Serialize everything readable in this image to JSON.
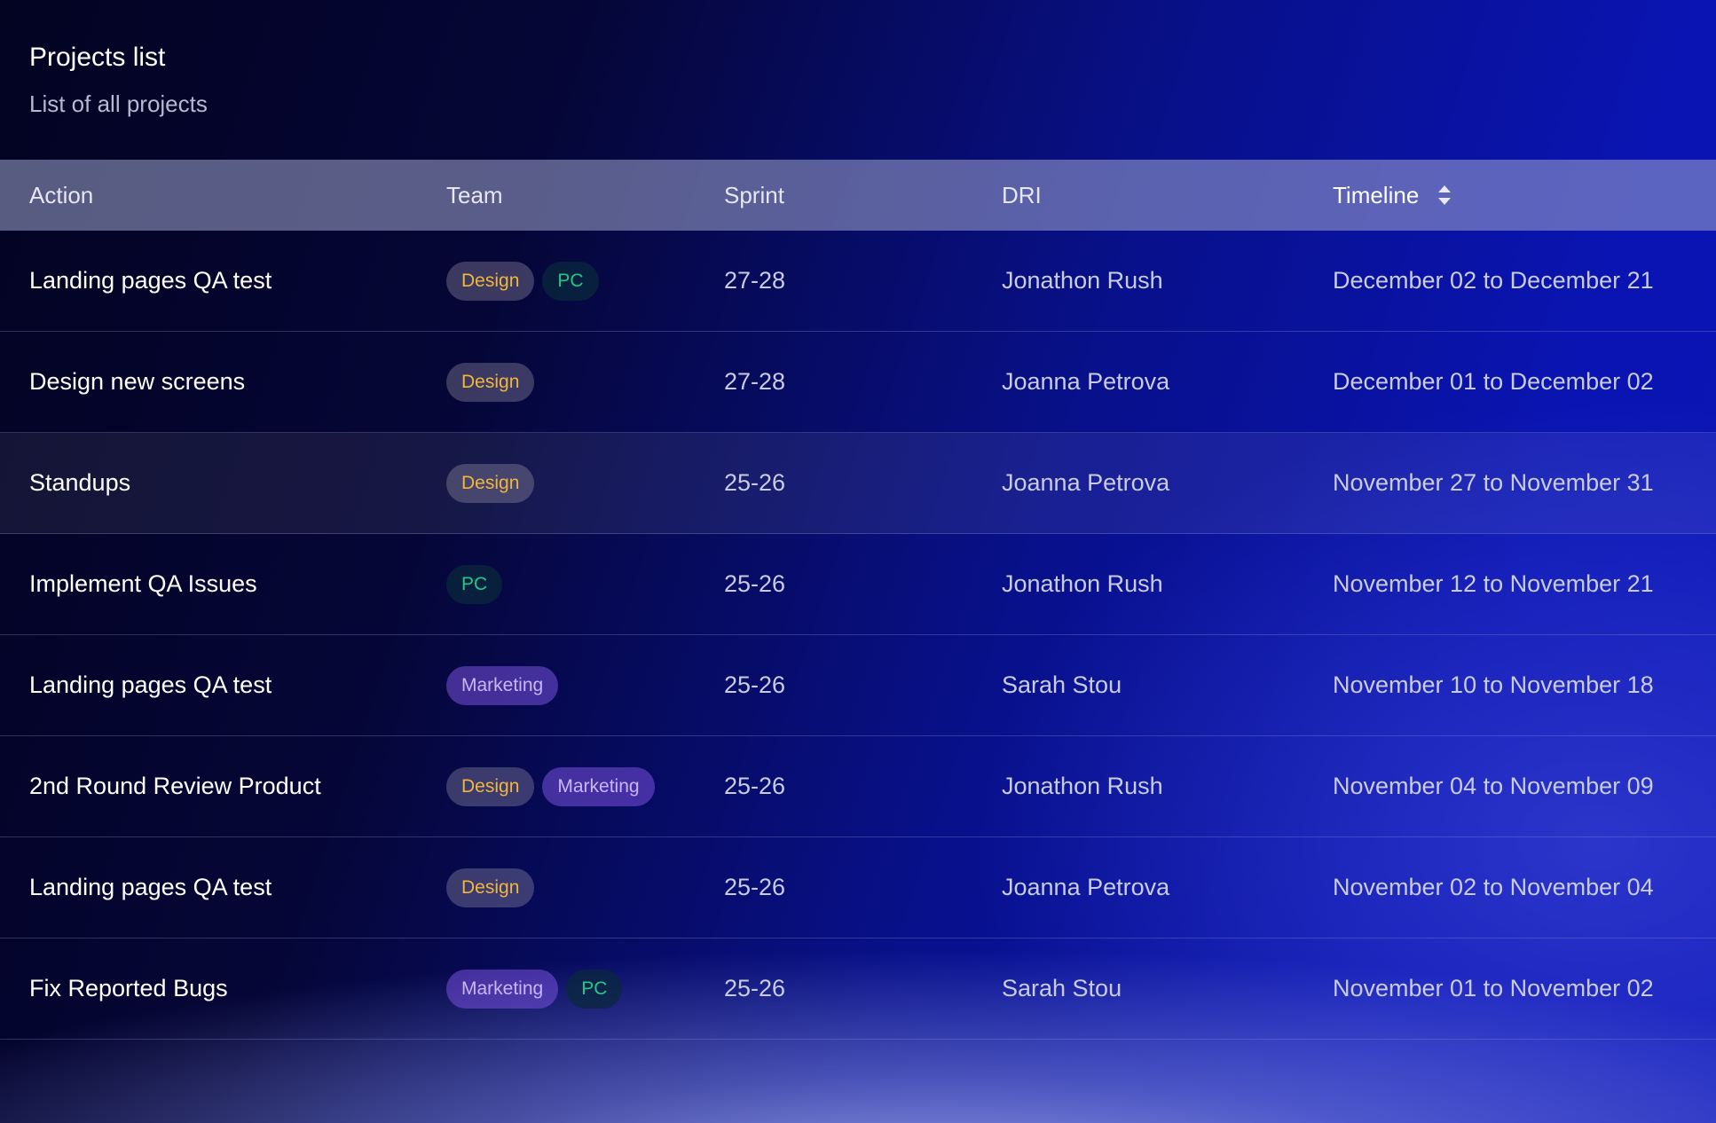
{
  "header": {
    "title": "Projects list",
    "subtitle": "List of all projects"
  },
  "table": {
    "columns": {
      "action": "Action",
      "team": "Team",
      "sprint": "Sprint",
      "dri": "DRI",
      "timeline": "Timeline"
    },
    "sorted_by": "timeline",
    "rows": [
      {
        "action": "Landing pages QA test",
        "tags": [
          "Design",
          "PC"
        ],
        "sprint": "27-28",
        "dri": "Jonathon Rush",
        "timeline": "December 02 to December 21"
      },
      {
        "action": "Design new screens",
        "tags": [
          "Design"
        ],
        "sprint": "27-28",
        "dri": "Joanna Petrova",
        "timeline": "December 01 to December 02"
      },
      {
        "action": "Standups",
        "tags": [
          "Design"
        ],
        "sprint": "25-26",
        "dri": "Joanna Petrova",
        "timeline": "November 27 to November 31"
      },
      {
        "action": "Implement QA Issues",
        "tags": [
          "PC"
        ],
        "sprint": "25-26",
        "dri": "Jonathon Rush",
        "timeline": "November 12 to November 21"
      },
      {
        "action": "Landing pages QA test",
        "tags": [
          "Marketing"
        ],
        "sprint": "25-26",
        "dri": "Sarah Stou",
        "timeline": "November 10 to November 18"
      },
      {
        "action": "2nd Round Review Product",
        "tags": [
          "Design",
          "Marketing"
        ],
        "sprint": "25-26",
        "dri": "Jonathon Rush",
        "timeline": "November 04 to November 09"
      },
      {
        "action": "Landing pages QA test",
        "tags": [
          "Design"
        ],
        "sprint": "25-26",
        "dri": "Joanna Petrova",
        "timeline": "November 02 to November 04"
      },
      {
        "action": "Fix Reported Bugs",
        "tags": [
          "Marketing",
          "PC"
        ],
        "sprint": "25-26",
        "dri": "Sarah Stou",
        "timeline": "November 01 to November 02"
      }
    ]
  },
  "tag_colors": {
    "Design": "#f2b63c",
    "PC": "#22c985",
    "Marketing": "#c8b6ff"
  }
}
